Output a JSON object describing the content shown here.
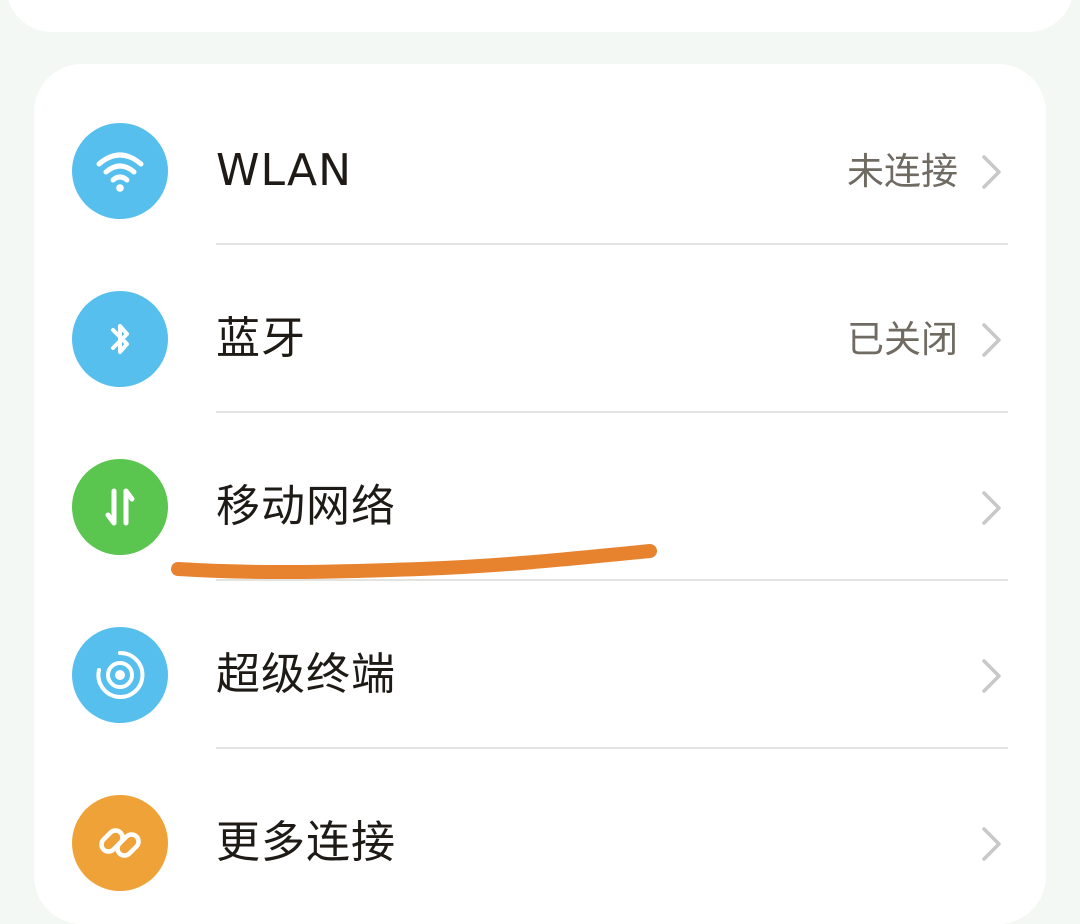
{
  "colors": {
    "wlan_icon_bg": "#57bfed",
    "bluetooth_icon_bg": "#57bfed",
    "mobile_network_icon_bg": "#5ac54f",
    "super_device_icon_bg": "#57bfed",
    "more_connections_icon_bg": "#efa237",
    "highlight_marker": "#e7822e"
  },
  "settings": {
    "items": [
      {
        "label": "WLAN",
        "status": "未连接",
        "icon": "wifi-icon"
      },
      {
        "label": "蓝牙",
        "status": "已关闭",
        "icon": "bluetooth-icon"
      },
      {
        "label": "移动网络",
        "status": "",
        "icon": "mobile-data-arrows-icon"
      },
      {
        "label": "超级终端",
        "status": "",
        "icon": "super-device-icon"
      },
      {
        "label": "更多连接",
        "status": "",
        "icon": "link-chain-icon"
      }
    ]
  }
}
